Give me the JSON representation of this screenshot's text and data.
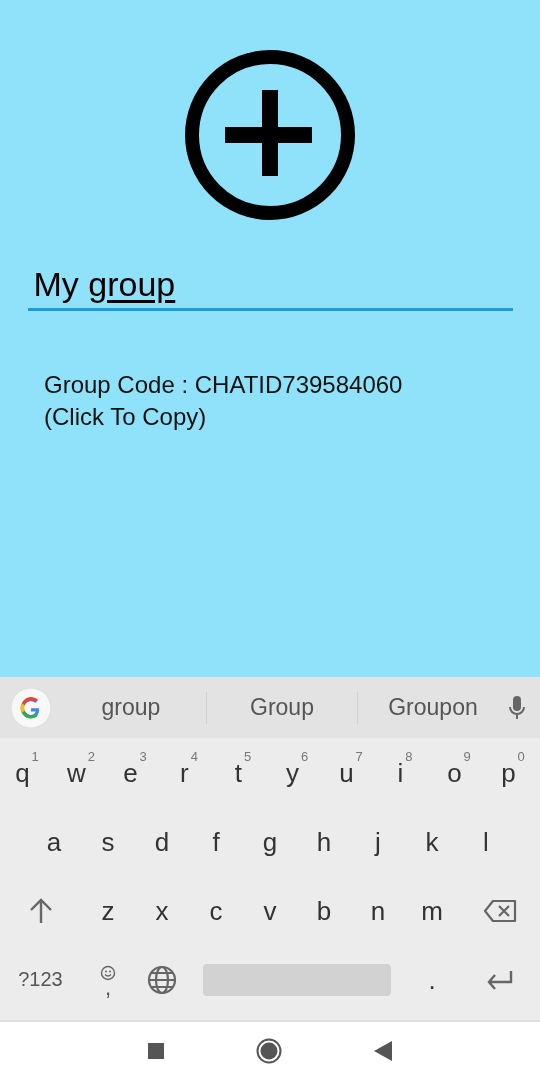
{
  "name_field": {
    "parts": [
      {
        "text": "My ",
        "composing": false
      },
      {
        "text": "group",
        "composing": true
      }
    ]
  },
  "group_code": "Group Code : CHATID739584060 (Click To Copy)",
  "suggestions": [
    {
      "text": "group"
    },
    {
      "text": "Group"
    },
    {
      "text": "Groupon"
    }
  ],
  "keyboard_rows": [
    [
      {
        "kind": "letter",
        "label": "q",
        "hint": "1"
      },
      {
        "kind": "letter",
        "label": "w",
        "hint": "2"
      },
      {
        "kind": "letter",
        "label": "e",
        "hint": "3"
      },
      {
        "kind": "letter",
        "label": "r",
        "hint": "4"
      },
      {
        "kind": "letter",
        "label": "t",
        "hint": "5"
      },
      {
        "kind": "letter",
        "label": "y",
        "hint": "6"
      },
      {
        "kind": "letter",
        "label": "u",
        "hint": "7"
      },
      {
        "kind": "letter",
        "label": "i",
        "hint": "8"
      },
      {
        "kind": "letter",
        "label": "o",
        "hint": "9"
      },
      {
        "kind": "letter",
        "label": "p",
        "hint": "0"
      }
    ],
    [
      {
        "kind": "letter",
        "label": "a"
      },
      {
        "kind": "letter",
        "label": "s"
      },
      {
        "kind": "letter",
        "label": "d"
      },
      {
        "kind": "letter",
        "label": "f"
      },
      {
        "kind": "letter",
        "label": "g"
      },
      {
        "kind": "letter",
        "label": "h"
      },
      {
        "kind": "letter",
        "label": "j"
      },
      {
        "kind": "letter",
        "label": "k"
      },
      {
        "kind": "letter",
        "label": "l"
      }
    ],
    [
      {
        "kind": "shift"
      },
      {
        "kind": "letter",
        "label": "z"
      },
      {
        "kind": "letter",
        "label": "x"
      },
      {
        "kind": "letter",
        "label": "c"
      },
      {
        "kind": "letter",
        "label": "v"
      },
      {
        "kind": "letter",
        "label": "b"
      },
      {
        "kind": "letter",
        "label": "n"
      },
      {
        "kind": "letter",
        "label": "m"
      },
      {
        "kind": "backspace"
      }
    ],
    [
      {
        "kind": "symbols",
        "label": "?123"
      },
      {
        "kind": "emoji",
        "label": ","
      },
      {
        "kind": "globe"
      },
      {
        "kind": "space"
      },
      {
        "kind": "letter",
        "label": "."
      },
      {
        "kind": "enter"
      }
    ]
  ]
}
